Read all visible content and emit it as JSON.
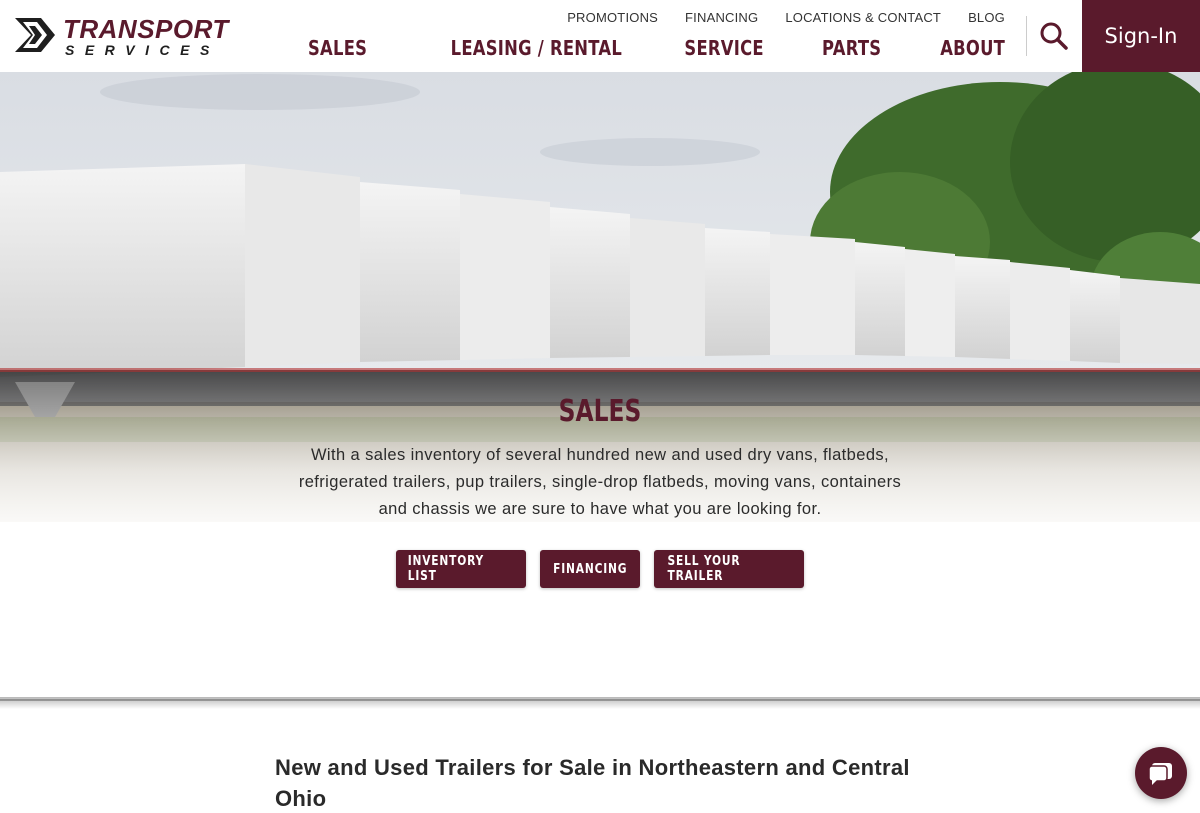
{
  "brand": {
    "name_top": "TRANSPORT",
    "name_bottom": "SERVICES",
    "primary_color": "#5a1a2c"
  },
  "utility_nav": [
    "PROMOTIONS",
    "FINANCING",
    "LOCATIONS & CONTACT",
    "BLOG"
  ],
  "main_nav": [
    "SALES",
    "LEASING / RENTAL",
    "SERVICE",
    "PARTS",
    "ABOUT"
  ],
  "header": {
    "search_icon": "search-icon",
    "signin_label": "Sign-In"
  },
  "hero": {
    "title": "SALES",
    "description": "With a sales inventory of several hundred new and used dry vans, flatbeds, refrigerated trailers, pup trailers, single-drop flatbeds, moving vans, containers and chassis we are sure to have what you are looking for.",
    "buttons": [
      "INVENTORY LIST",
      "FINANCING",
      "SELL YOUR TRAILER"
    ]
  },
  "section": {
    "heading": "New and Used Trailers for Sale in Northeastern and Central Ohio"
  },
  "chat": {
    "icon": "chat-bubble-icon"
  }
}
